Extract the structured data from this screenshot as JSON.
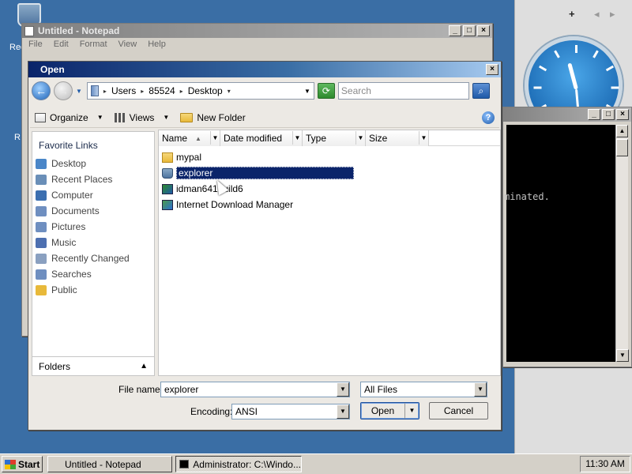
{
  "desktop": {
    "label_1": "Rec",
    "label_2": "R"
  },
  "sidebar": {
    "add": "+",
    "prev": "◂",
    "next": "▸"
  },
  "notepad": {
    "title": "Untitled - Notepad",
    "menu": [
      "File",
      "Edit",
      "Format",
      "View",
      "Help"
    ]
  },
  "console": {
    "text": "minated."
  },
  "dialog": {
    "title": "Open",
    "address": [
      "Users",
      "85524",
      "Desktop"
    ],
    "search_placeholder": "Search",
    "toolbar": {
      "organize": "Organize",
      "views": "Views",
      "new_folder": "New Folder"
    },
    "favorite_links_header": "Favorite Links",
    "favorite_links": [
      {
        "label": "Desktop",
        "icon": "desktop-icon",
        "color": "#4a86c8"
      },
      {
        "label": "Recent Places",
        "icon": "recent-places-icon",
        "color": "#6a8fb8"
      },
      {
        "label": "Computer",
        "icon": "computer-icon",
        "color": "#3c6fb0"
      },
      {
        "label": "Documents",
        "icon": "documents-icon",
        "color": "#6f8fc0"
      },
      {
        "label": "Pictures",
        "icon": "pictures-icon",
        "color": "#6f8fc0"
      },
      {
        "label": "Music",
        "icon": "music-icon",
        "color": "#4d6fb0"
      },
      {
        "label": "Recently Changed",
        "icon": "recently-changed-icon",
        "color": "#8aa0c0"
      },
      {
        "label": "Searches",
        "icon": "searches-icon",
        "color": "#6f8fc0"
      },
      {
        "label": "Public",
        "icon": "public-folder-icon",
        "color": "#e8b93a"
      }
    ],
    "folders_label": "Folders",
    "columns": [
      "Name",
      "Date modified",
      "Type",
      "Size"
    ],
    "files": [
      {
        "name": "mypal",
        "icon": "folder-icon"
      },
      {
        "name": "explorer",
        "icon": "recycle-bin-icon",
        "selected": true
      },
      {
        "name": "idman641build6",
        "icon": "installer-icon"
      },
      {
        "name": "Internet Download Manager",
        "icon": "shortcut-icon"
      }
    ],
    "file_name_label": "File name:",
    "file_name_value": "explorer",
    "file_type_value": "All Files",
    "encoding_label": "Encoding:",
    "encoding_value": "ANSI",
    "open_label": "Open",
    "cancel_label": "Cancel"
  },
  "taskbar": {
    "start": "Start",
    "tasks": [
      "Untitled - Notepad",
      "Administrator: C:\\Windo..."
    ],
    "clock": "11:30 AM"
  }
}
